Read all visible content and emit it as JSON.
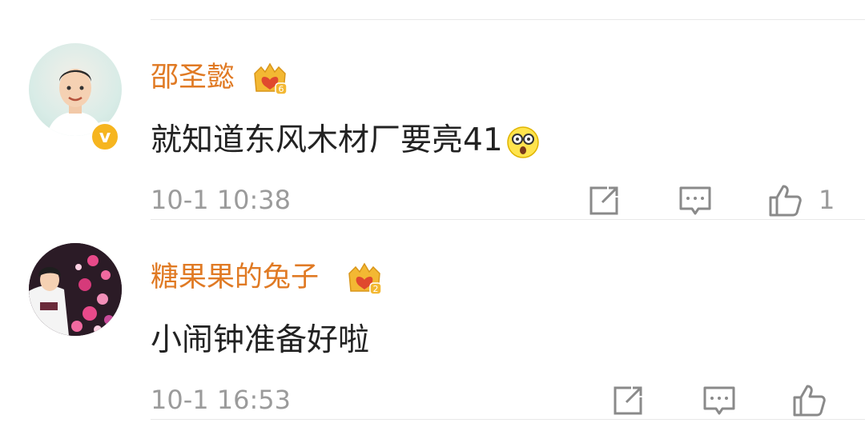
{
  "comments": [
    {
      "username": "邵圣懿",
      "crown_level": "6",
      "verified": true,
      "text": "就知道东风木材厂要亮41",
      "emoji": "shocked-emoji",
      "time": "10-1 10:38",
      "like_count": "1"
    },
    {
      "username": "糖果果的兔子",
      "crown_level": "2",
      "verified": false,
      "text": "小闹钟准备好啦",
      "time": "10-1 16:53",
      "like_count": ""
    }
  ],
  "colors": {
    "username": "#e07a24",
    "text": "#222222",
    "meta": "#9b9b9b",
    "icon": "#8a8a8a",
    "crown": "#f3b833"
  }
}
